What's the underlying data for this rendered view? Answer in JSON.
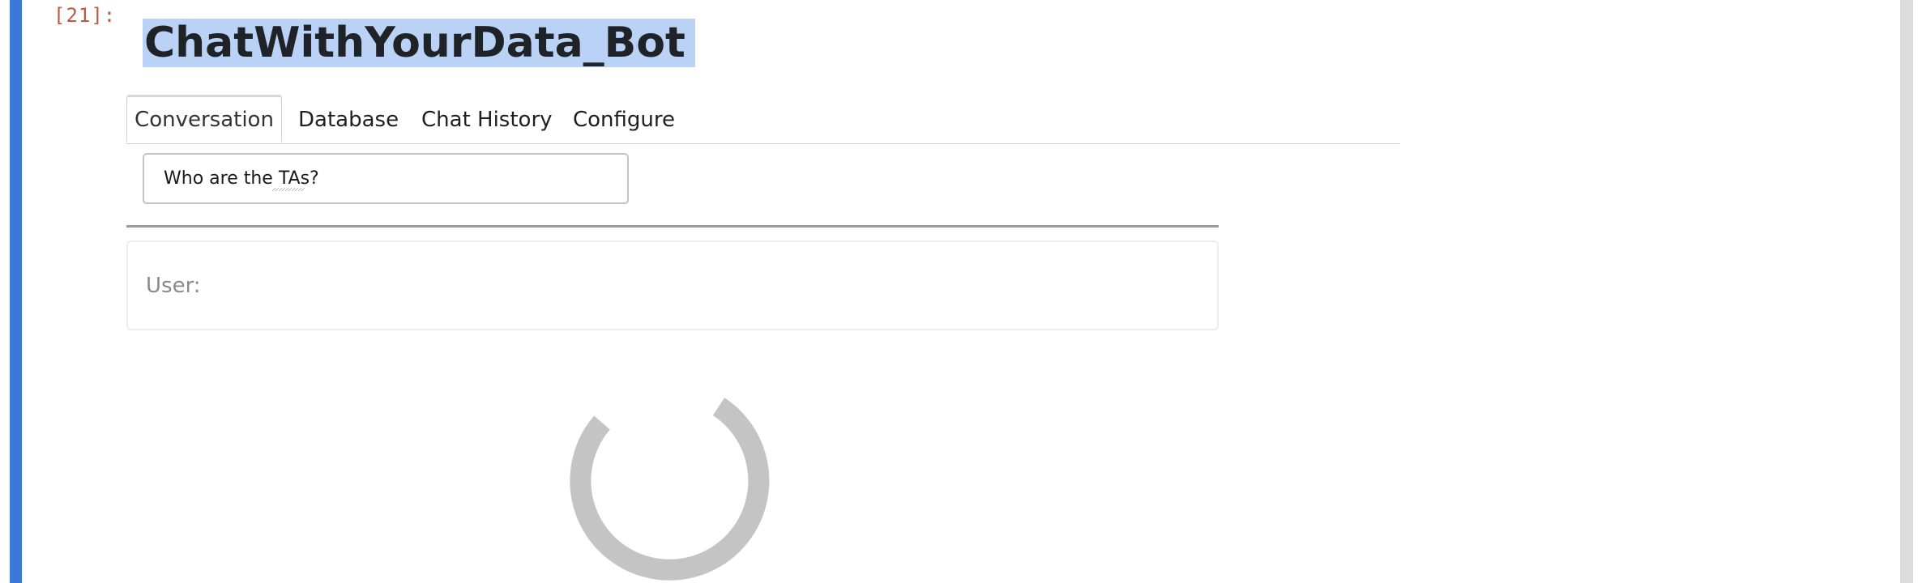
{
  "cell": {
    "prompt": "[21]:"
  },
  "app": {
    "title": "ChatWithYourData_Bot"
  },
  "tabs": [
    {
      "label": "Conversation",
      "active": true
    },
    {
      "label": "Database",
      "active": false
    },
    {
      "label": "Chat History",
      "active": false
    },
    {
      "label": "Configure",
      "active": false
    }
  ],
  "conversation": {
    "query_value": "Who are the TAs?",
    "user_label": "User:"
  },
  "icons": {
    "loading": "loading-spinner-icon"
  },
  "colors": {
    "cell_accent": "#3b78d8",
    "title_highlight": "#b9d2f5",
    "prompt": "#c05a3f",
    "spinner": "#c4c4c4"
  }
}
